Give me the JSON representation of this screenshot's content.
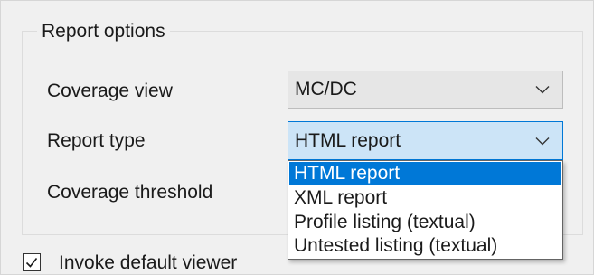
{
  "group": {
    "title": "Report options"
  },
  "fields": {
    "coverage_view": {
      "label": "Coverage view",
      "value": "MC/DC"
    },
    "report_type": {
      "label": "Report type",
      "value": "HTML report"
    },
    "coverage_threshold": {
      "label": "Coverage threshold"
    }
  },
  "dropdown": {
    "options": [
      "HTML report",
      "XML report",
      "Profile listing (textual)",
      "Untested listing (textual)"
    ],
    "selected_index": 0
  },
  "invoke_viewer": {
    "label": "Invoke default viewer",
    "checked": true
  },
  "icons": {
    "combo_arrow": "chevron-down-icon",
    "checkbox_mark": "checkmark-icon"
  },
  "colors": {
    "highlight": "#0078d7",
    "focus_fill": "#cce4f7"
  }
}
